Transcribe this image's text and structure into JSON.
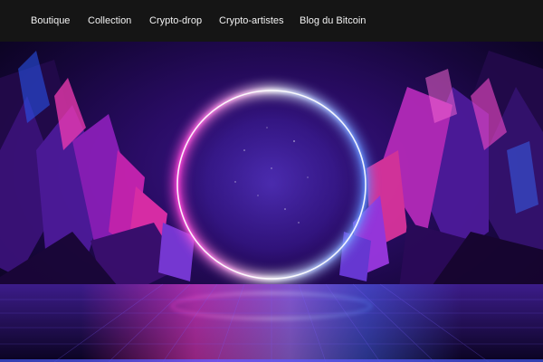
{
  "nav": {
    "items": [
      {
        "label": "Boutique"
      },
      {
        "label": "Collection"
      },
      {
        "label": "Crypto-drop"
      },
      {
        "label": "Crypto-artistes"
      },
      {
        "label": "Blog du Bitcoin"
      }
    ]
  },
  "hero": {
    "image_icon": "neon-ring-tunnel-image",
    "colors": {
      "ring": "#ffffff",
      "ring_glow_left": "#ff2bd6",
      "ring_glow_right": "#3f6bff",
      "background": "#1a0836",
      "accent_pink": "#e4218f",
      "accent_blue": "#3a2cff"
    }
  }
}
